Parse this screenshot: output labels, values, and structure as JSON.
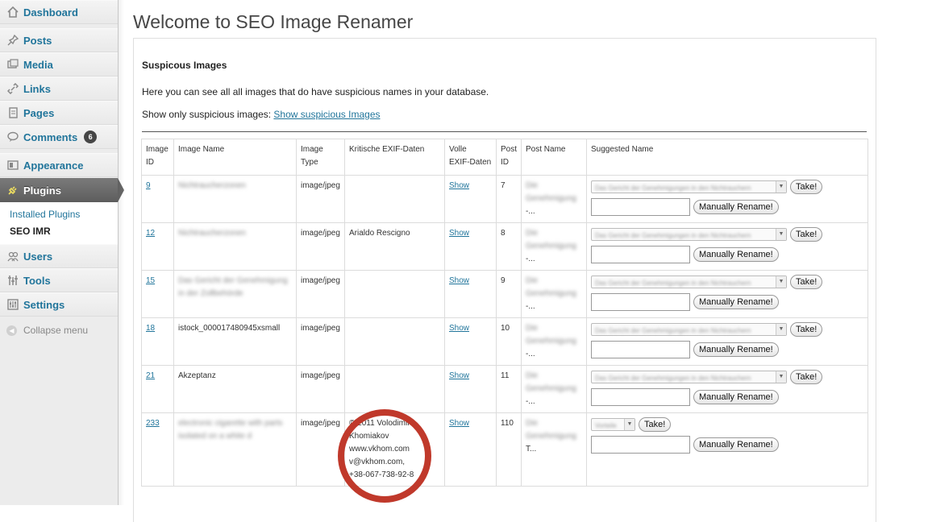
{
  "sidebar": {
    "items": [
      {
        "label": "Dashboard",
        "icon": "dashboard-icon"
      },
      {
        "label": "Posts",
        "icon": "pin-icon"
      },
      {
        "label": "Media",
        "icon": "media-icon"
      },
      {
        "label": "Links",
        "icon": "link-icon"
      },
      {
        "label": "Pages",
        "icon": "page-icon"
      },
      {
        "label": "Comments",
        "icon": "comment-icon",
        "badge": "6"
      },
      {
        "label": "Appearance",
        "icon": "appearance-icon"
      },
      {
        "label": "Plugins",
        "icon": "plug-icon"
      },
      {
        "label": "Users",
        "icon": "users-icon"
      },
      {
        "label": "Tools",
        "icon": "tools-icon"
      },
      {
        "label": "Settings",
        "icon": "settings-icon"
      }
    ],
    "submenu": [
      "Installed Plugins",
      "SEO IMR"
    ],
    "collapse_label": "Collapse menu"
  },
  "page": {
    "title": "Welcome to SEO Image Renamer",
    "section_title": "Suspicous Images",
    "intro": "Here you can see all all images that do have suspicious names in your database.",
    "show_only_label": "Show only suspicious images:",
    "show_link": "Show suspicious Images"
  },
  "table": {
    "headers": {
      "image_id": [
        "Image",
        "ID"
      ],
      "image_name": "Image Name",
      "image_type": [
        "Image",
        "Type"
      ],
      "exif_critical": "Kritische EXIF-Daten",
      "exif_full": [
        "Volle",
        "EXIF-Daten"
      ],
      "post_id": [
        "Post",
        "ID"
      ],
      "post_name": "Post Name",
      "suggested": "Suggested Name"
    },
    "show_label": "Show",
    "take_label": "Take!",
    "rename_label": "Manually Rename!",
    "rows": [
      {
        "id": "9",
        "name": "Nichtraucherzonen",
        "type": "image/jpeg",
        "exif": [],
        "post_id": "7",
        "post_name": [
          "Die",
          "Genehmigung",
          "-..."
        ],
        "suggest": "Das Gericht der Genehmigungen in den Nichtrauchern"
      },
      {
        "id": "12",
        "name": "Nichtraucherzonen",
        "type": "image/jpeg",
        "exif": [
          "Arialdo Rescigno"
        ],
        "post_id": "8",
        "post_name": [
          "Die",
          "Genehmigung",
          "-..."
        ],
        "suggest": "Das Gericht der Genehmigungen in den Nichtrauchern"
      },
      {
        "id": "15",
        "name": "Das Gericht der Genehmigung in der Zollbehörde",
        "type": "image/jpeg",
        "exif": [],
        "post_id": "9",
        "post_name": [
          "Die",
          "Genehmigung",
          "-..."
        ],
        "suggest": "Das Gericht der Genehmigungen in den Nichtrauchern"
      },
      {
        "id": "18",
        "name": "istock_000017480945xsmall",
        "type": "image/jpeg",
        "exif": [],
        "post_id": "10",
        "post_name": [
          "Die",
          "Genehmigung",
          "-..."
        ],
        "suggest": "Das Gericht der Genehmigungen in den Nichtrauchern"
      },
      {
        "id": "21",
        "name": "Akzeptanz",
        "type": "image/jpeg",
        "exif": [],
        "post_id": "11",
        "post_name": [
          "Die",
          "Genehmigung",
          "-..."
        ],
        "suggest": "Das Gericht der Genehmigungen in den Nichtrauchern"
      },
      {
        "id": "233",
        "name": "electronic cigarette with parts isolated on a white d",
        "type": "image/jpeg",
        "exif": [
          "© 2011 Volodimir",
          "Khomiakov",
          "www.vkhom.com",
          "v@vkhom.com,",
          "+38-067-738-92-8"
        ],
        "post_id": "110",
        "post_name": [
          "Die",
          "Genehmigung",
          "T..."
        ],
        "suggest": "Vorteile"
      }
    ]
  },
  "colors": {
    "link": "#21759b",
    "annotation_circle": "#c0392b",
    "active_menu": "#686868"
  }
}
